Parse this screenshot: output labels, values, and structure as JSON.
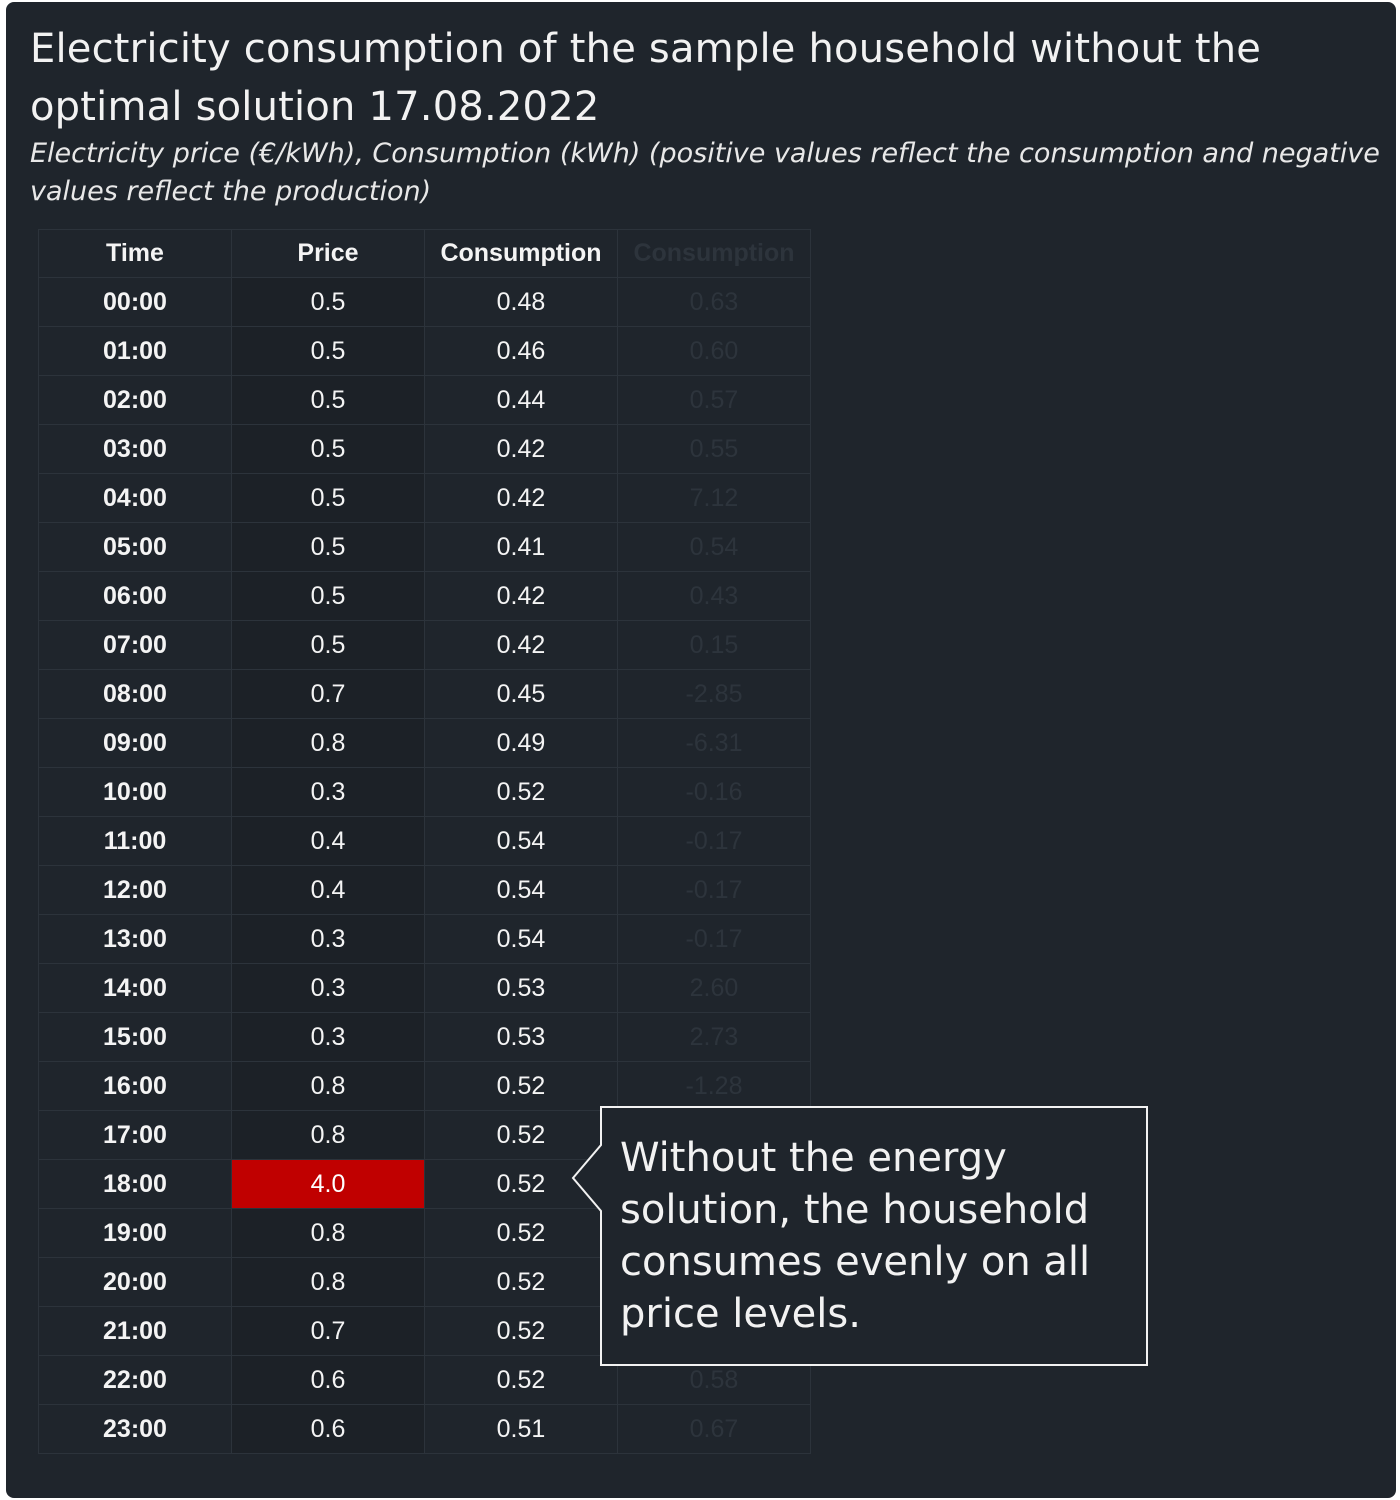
{
  "title": "Electricity consumption of the sample household without the optimal solution 17.08.2022",
  "subtitle": "Electricity price (€/kWh), Consumption (kWh) (positive values reflect the consumption and negative values reflect the production)",
  "columns": [
    "Time",
    "Price",
    "Consumption",
    "Consumption"
  ],
  "callout": "Without the energy solution, the household consumes evenly on all price levels.",
  "colors": {
    "background": "#1f252c",
    "highlight": "#c00000",
    "text": "#f4f4f4",
    "faded_text": "#2d343c"
  },
  "chart_data": {
    "type": "table",
    "title": "Electricity consumption of the sample household without the optimal solution 17.08.2022",
    "subtitle": "Electricity price (€/kWh), Consumption (kWh) (positive values reflect the consumption and negative values reflect the production)",
    "highlighted_cell": {
      "row": "18:00",
      "column": "Price"
    },
    "rows": [
      {
        "time": "00:00",
        "price": "0.5",
        "consumption": "0.48",
        "consumption_faded": "0.63"
      },
      {
        "time": "01:00",
        "price": "0.5",
        "consumption": "0.46",
        "consumption_faded": "0.60"
      },
      {
        "time": "02:00",
        "price": "0.5",
        "consumption": "0.44",
        "consumption_faded": "0.57"
      },
      {
        "time": "03:00",
        "price": "0.5",
        "consumption": "0.42",
        "consumption_faded": "0.55"
      },
      {
        "time": "04:00",
        "price": "0.5",
        "consumption": "0.42",
        "consumption_faded": "7.12"
      },
      {
        "time": "05:00",
        "price": "0.5",
        "consumption": "0.41",
        "consumption_faded": "0.54"
      },
      {
        "time": "06:00",
        "price": "0.5",
        "consumption": "0.42",
        "consumption_faded": "0.43"
      },
      {
        "time": "07:00",
        "price": "0.5",
        "consumption": "0.42",
        "consumption_faded": "0.15"
      },
      {
        "time": "08:00",
        "price": "0.7",
        "consumption": "0.45",
        "consumption_faded": "-2.85"
      },
      {
        "time": "09:00",
        "price": "0.8",
        "consumption": "0.49",
        "consumption_faded": "-6.31"
      },
      {
        "time": "10:00",
        "price": "0.3",
        "consumption": "0.52",
        "consumption_faded": "-0.16"
      },
      {
        "time": "11:00",
        "price": "0.4",
        "consumption": "0.54",
        "consumption_faded": "-0.17"
      },
      {
        "time": "12:00",
        "price": "0.4",
        "consumption": "0.54",
        "consumption_faded": "-0.17"
      },
      {
        "time": "13:00",
        "price": "0.3",
        "consumption": "0.54",
        "consumption_faded": "-0.17"
      },
      {
        "time": "14:00",
        "price": "0.3",
        "consumption": "0.53",
        "consumption_faded": "2.60"
      },
      {
        "time": "15:00",
        "price": "0.3",
        "consumption": "0.53",
        "consumption_faded": "2.73"
      },
      {
        "time": "16:00",
        "price": "0.8",
        "consumption": "0.52",
        "consumption_faded": "-1.28"
      },
      {
        "time": "17:00",
        "price": "0.8",
        "consumption": "0.52",
        "consumption_faded": ""
      },
      {
        "time": "18:00",
        "price": "4.0",
        "consumption": "0.52",
        "consumption_faded": ""
      },
      {
        "time": "19:00",
        "price": "0.8",
        "consumption": "0.52",
        "consumption_faded": ""
      },
      {
        "time": "20:00",
        "price": "0.8",
        "consumption": "0.52",
        "consumption_faded": ""
      },
      {
        "time": "21:00",
        "price": "0.7",
        "consumption": "0.52",
        "consumption_faded": ""
      },
      {
        "time": "22:00",
        "price": "0.6",
        "consumption": "0.52",
        "consumption_faded": "0.58"
      },
      {
        "time": "23:00",
        "price": "0.6",
        "consumption": "0.51",
        "consumption_faded": "0.67"
      }
    ]
  }
}
